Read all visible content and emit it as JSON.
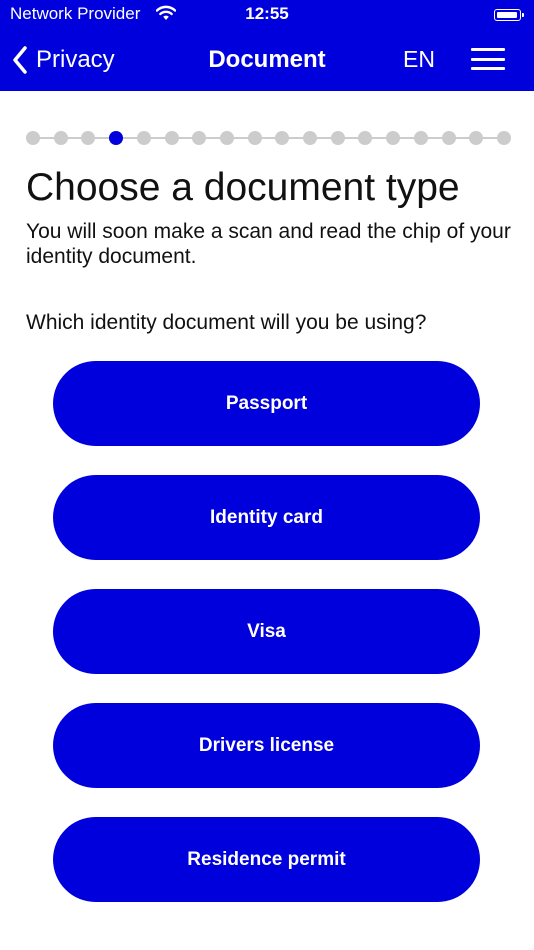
{
  "status_bar": {
    "carrier": "Network Provider",
    "time": "12:55"
  },
  "nav": {
    "back_label": "Privacy",
    "title": "Document",
    "language": "EN"
  },
  "progress": {
    "total_steps": 18,
    "current_step": 4
  },
  "content": {
    "title": "Choose a document type",
    "subtitle": "You will soon make a scan and read the chip of your identity document.",
    "question": "Which identity document will you be using?"
  },
  "options": [
    {
      "label": "Passport"
    },
    {
      "label": "Identity card"
    },
    {
      "label": "Visa"
    },
    {
      "label": "Drivers license"
    },
    {
      "label": "Residence permit"
    }
  ],
  "colors": {
    "primary": "#0000dd",
    "inactive_step": "#cccccc",
    "text": "#111111"
  }
}
